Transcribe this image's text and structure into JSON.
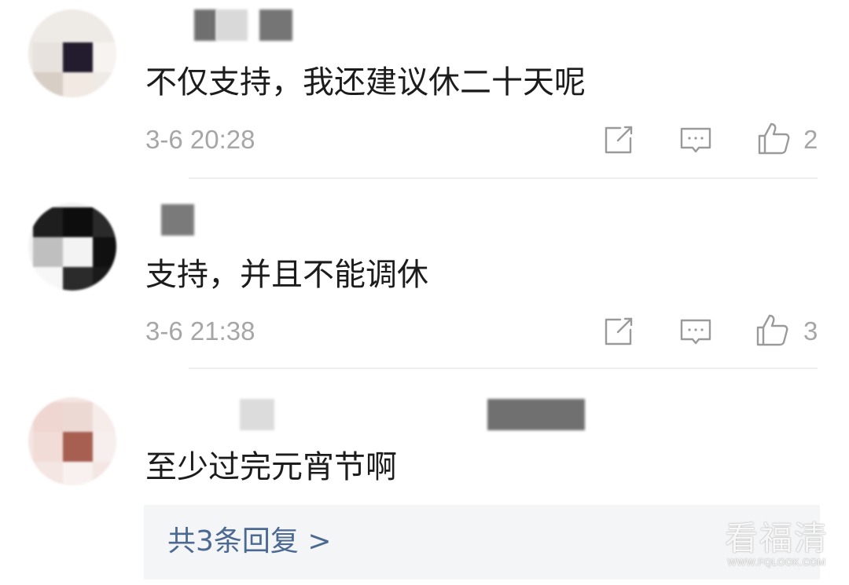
{
  "comments": [
    {
      "text": "不仅支持，我还建议休二十天呢",
      "time": "3-6 20:28",
      "likes": "2"
    },
    {
      "text": "支持，并且不能调休",
      "time": "3-6 21:38",
      "likes": "3"
    },
    {
      "text": "至少过完元宵节啊"
    }
  ],
  "replies": {
    "label": "共3条回复 >"
  },
  "watermark": {
    "title": "看福清",
    "url": "WWW.FQLOOK.COM"
  },
  "icons": {
    "forward": "share-icon",
    "comment": "comment-icon",
    "like": "thumbs-up-icon"
  },
  "colors": {
    "link": "#4b6991",
    "meta": "#a6a6a6",
    "reply_bg": "#f4f5f7"
  }
}
